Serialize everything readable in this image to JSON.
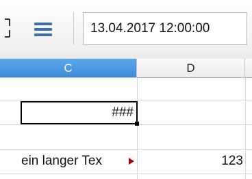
{
  "formula_bar": {
    "content": "13.04.2017 12:00:00"
  },
  "columns": [
    {
      "label": "C",
      "selected": true
    },
    {
      "label": "D",
      "selected": false
    }
  ],
  "cells": {
    "c_active": "###",
    "c_text": "ein langer Tex",
    "d_number": "123"
  },
  "colors": {
    "selected_header": "#4a98e2",
    "overflow_indicator": "#b00000",
    "function_icon": "#3b6fb3"
  },
  "icons": [
    "toolbar-fragment-icon",
    "function-wizard-icon",
    "text-overflow-arrow-icon",
    "fill-handle-icon"
  ]
}
